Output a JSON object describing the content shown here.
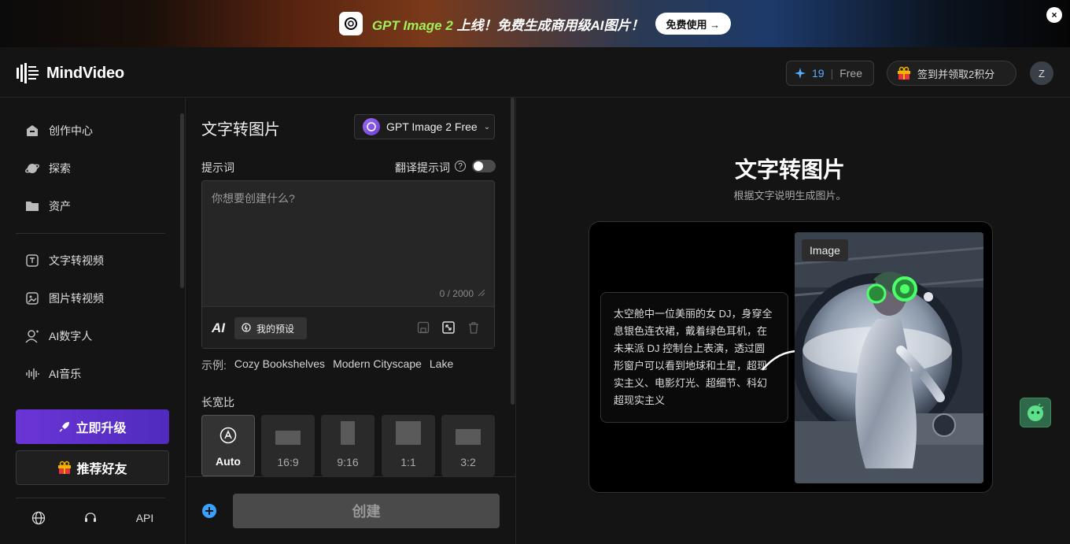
{
  "banner": {
    "title_highlight": "GPT Image 2",
    "title_rest": " 上线！免费生成商用级AI图片！",
    "cta": "免费使用 →",
    "close": "×"
  },
  "header": {
    "brand": "MindVideo",
    "credits": "19",
    "plan": "Free",
    "checkin": "签到并领取2积分",
    "avatar": "Z"
  },
  "sidebar": {
    "items": [
      {
        "label": "创作中心"
      },
      {
        "label": "探索"
      },
      {
        "label": "资产"
      },
      {
        "label": "文字转视频"
      },
      {
        "label": "图片转视频"
      },
      {
        "label": "AI数字人"
      },
      {
        "label": "AI音乐"
      }
    ],
    "upgrade": "立即升级",
    "refer": "推荐好友",
    "api": "API"
  },
  "panel": {
    "title": "文字转图片",
    "model": "GPT Image 2 Free",
    "prompt_label": "提示词",
    "translate_label": "翻译提示词",
    "placeholder": "你想要创建什么?",
    "counter": "0 / 2000",
    "ai_badge": "AI",
    "preset": "我的预设",
    "examples_label": "示例:",
    "examples": [
      "Cozy Bookshelves",
      "Modern Cityscape",
      "Lake"
    ],
    "ratio_label": "长宽比",
    "ratios": [
      "Auto",
      "16:9",
      "9:16",
      "1:1",
      "3:2"
    ],
    "create": "创建"
  },
  "main": {
    "title": "文字转图片",
    "subtitle": "根据文字说明生成图片。",
    "sample_prompt": "太空舱中一位美丽的女 DJ，身穿全息银色连衣裙，戴着绿色耳机，在未来派 DJ 控制台上表演，透过圆形窗户可以看到地球和土星，超现实主义、电影灯光、超细节、科幻超现实主义",
    "image_tag": "Image"
  },
  "colors": {
    "accent_blue": "#5ab0ff",
    "upgrade_purple": "#6b35d6",
    "headphone_green": "#4cff6a"
  }
}
